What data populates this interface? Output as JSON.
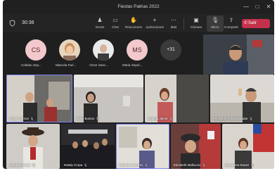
{
  "window": {
    "title": "Fiestas Patrias 2022"
  },
  "toolbar": {
    "timer": "30:36",
    "buttons": [
      "Gente",
      "Chat",
      "Reacciones",
      "Aplicaciones",
      "Más",
      "Cámara",
      "Micro",
      "Compartir"
    ],
    "leave_label": "Salir"
  },
  "avatars": [
    {
      "initials": "CS",
      "name": "Cristian Sep...",
      "color": "#f3c9cd"
    },
    {
      "initials": "",
      "name": "Marcela Fari...",
      "color": "#e8d2b8"
    },
    {
      "initials": "",
      "name": "Victor Sanc...",
      "color": "#d9d9d9"
    },
    {
      "initials": "MS",
      "name": "Maria Sepul...",
      "color": "#f3c9cd"
    }
  ],
  "overflow_count": "+31",
  "tiles": [
    {
      "name": "Cesar Carrion"
    },
    {
      "name": "Erika Bustos"
    },
    {
      "name": "Claudia Jaime"
    },
    {
      "name": "Fernando Funck Saladar"
    },
    {
      "name": "Ivandro Oviedo"
    },
    {
      "name": "Nataly Corpa"
    },
    {
      "name": "Fabiola Gutierrez"
    },
    {
      "name": "Elizabeth Molluccio"
    },
    {
      "name": "Macarena Nunez"
    }
  ]
}
